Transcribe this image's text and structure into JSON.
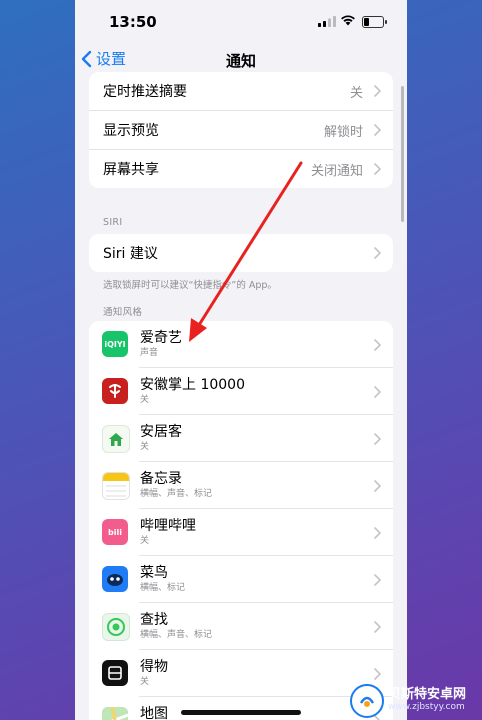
{
  "status": {
    "time": "13:50"
  },
  "nav": {
    "back_label": "设置",
    "title": "通知"
  },
  "group_top": [
    {
      "label": "定时推送摘要",
      "value": "关"
    },
    {
      "label": "显示预览",
      "value": "解锁时"
    },
    {
      "label": "屏幕共享",
      "value": "关闭通知"
    }
  ],
  "siri": {
    "header": "SIRI",
    "label": "Siri 建议",
    "footnote": "选取锁屏时可以建议“快捷指令”的 App。"
  },
  "apps_section": {
    "header": "通知风格",
    "apps": [
      {
        "name": "爱奇艺",
        "sub": "声音",
        "icon": "iqiyi-icon",
        "color": "#18c46a"
      },
      {
        "name": "安徽掌上 10000",
        "sub": "关",
        "icon": "telecom-icon",
        "color": "#c8201d"
      },
      {
        "name": "安居客",
        "sub": "关",
        "icon": "anjuke-icon",
        "color": "#2ea84a"
      },
      {
        "name": "备忘录",
        "sub": "横幅、声音、标记",
        "icon": "notes-icon",
        "color": "#f5c518"
      },
      {
        "name": "哔哩哔哩",
        "sub": "关",
        "icon": "bilibili-icon",
        "color": "#f25d8e"
      },
      {
        "name": "菜鸟",
        "sub": "横幅、标记",
        "icon": "cainiao-icon",
        "color": "#1f7cf5"
      },
      {
        "name": "查找",
        "sub": "横幅、声音、标记",
        "icon": "find-my-icon",
        "color": "#34c759"
      },
      {
        "name": "得物",
        "sub": "关",
        "icon": "dewu-icon",
        "color": "#111111"
      },
      {
        "name": "地图",
        "sub": "",
        "icon": "maps-icon",
        "color": "#5ac8fa"
      }
    ]
  },
  "watermark": {
    "name": "贝斯特安卓网",
    "url": "www.zjbstyy.com"
  },
  "colors": {
    "accent": "#1a7cf0",
    "arrow": "#e8231f",
    "background": "#f2f2f7"
  }
}
